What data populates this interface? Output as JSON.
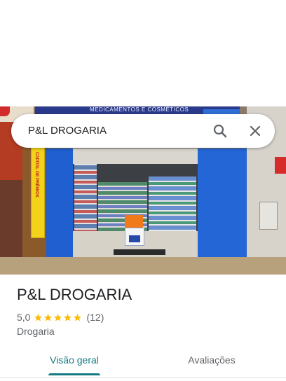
{
  "search": {
    "value": "P&L DROGARIA",
    "placeholder": ""
  },
  "icons": {
    "search": "search-icon",
    "close": "close-icon",
    "star": "star-icon"
  },
  "photo": {
    "sign_text": "MEDICAMENTOS E COSMÉTICOS",
    "banner_text": "CAPITAL DE PRÊMIOS"
  },
  "place": {
    "name": "P&L DROGARIA",
    "rating": "5,0",
    "stars": 5,
    "review_count": "(12)",
    "category": "Drogaria"
  },
  "tabs": [
    {
      "label": "Visão geral",
      "active": true
    },
    {
      "label": "Avaliações",
      "active": false
    }
  ],
  "colors": {
    "accent": "#137b82",
    "star": "#fbbc04",
    "text_primary": "#202124",
    "text_secondary": "#5f6368"
  }
}
